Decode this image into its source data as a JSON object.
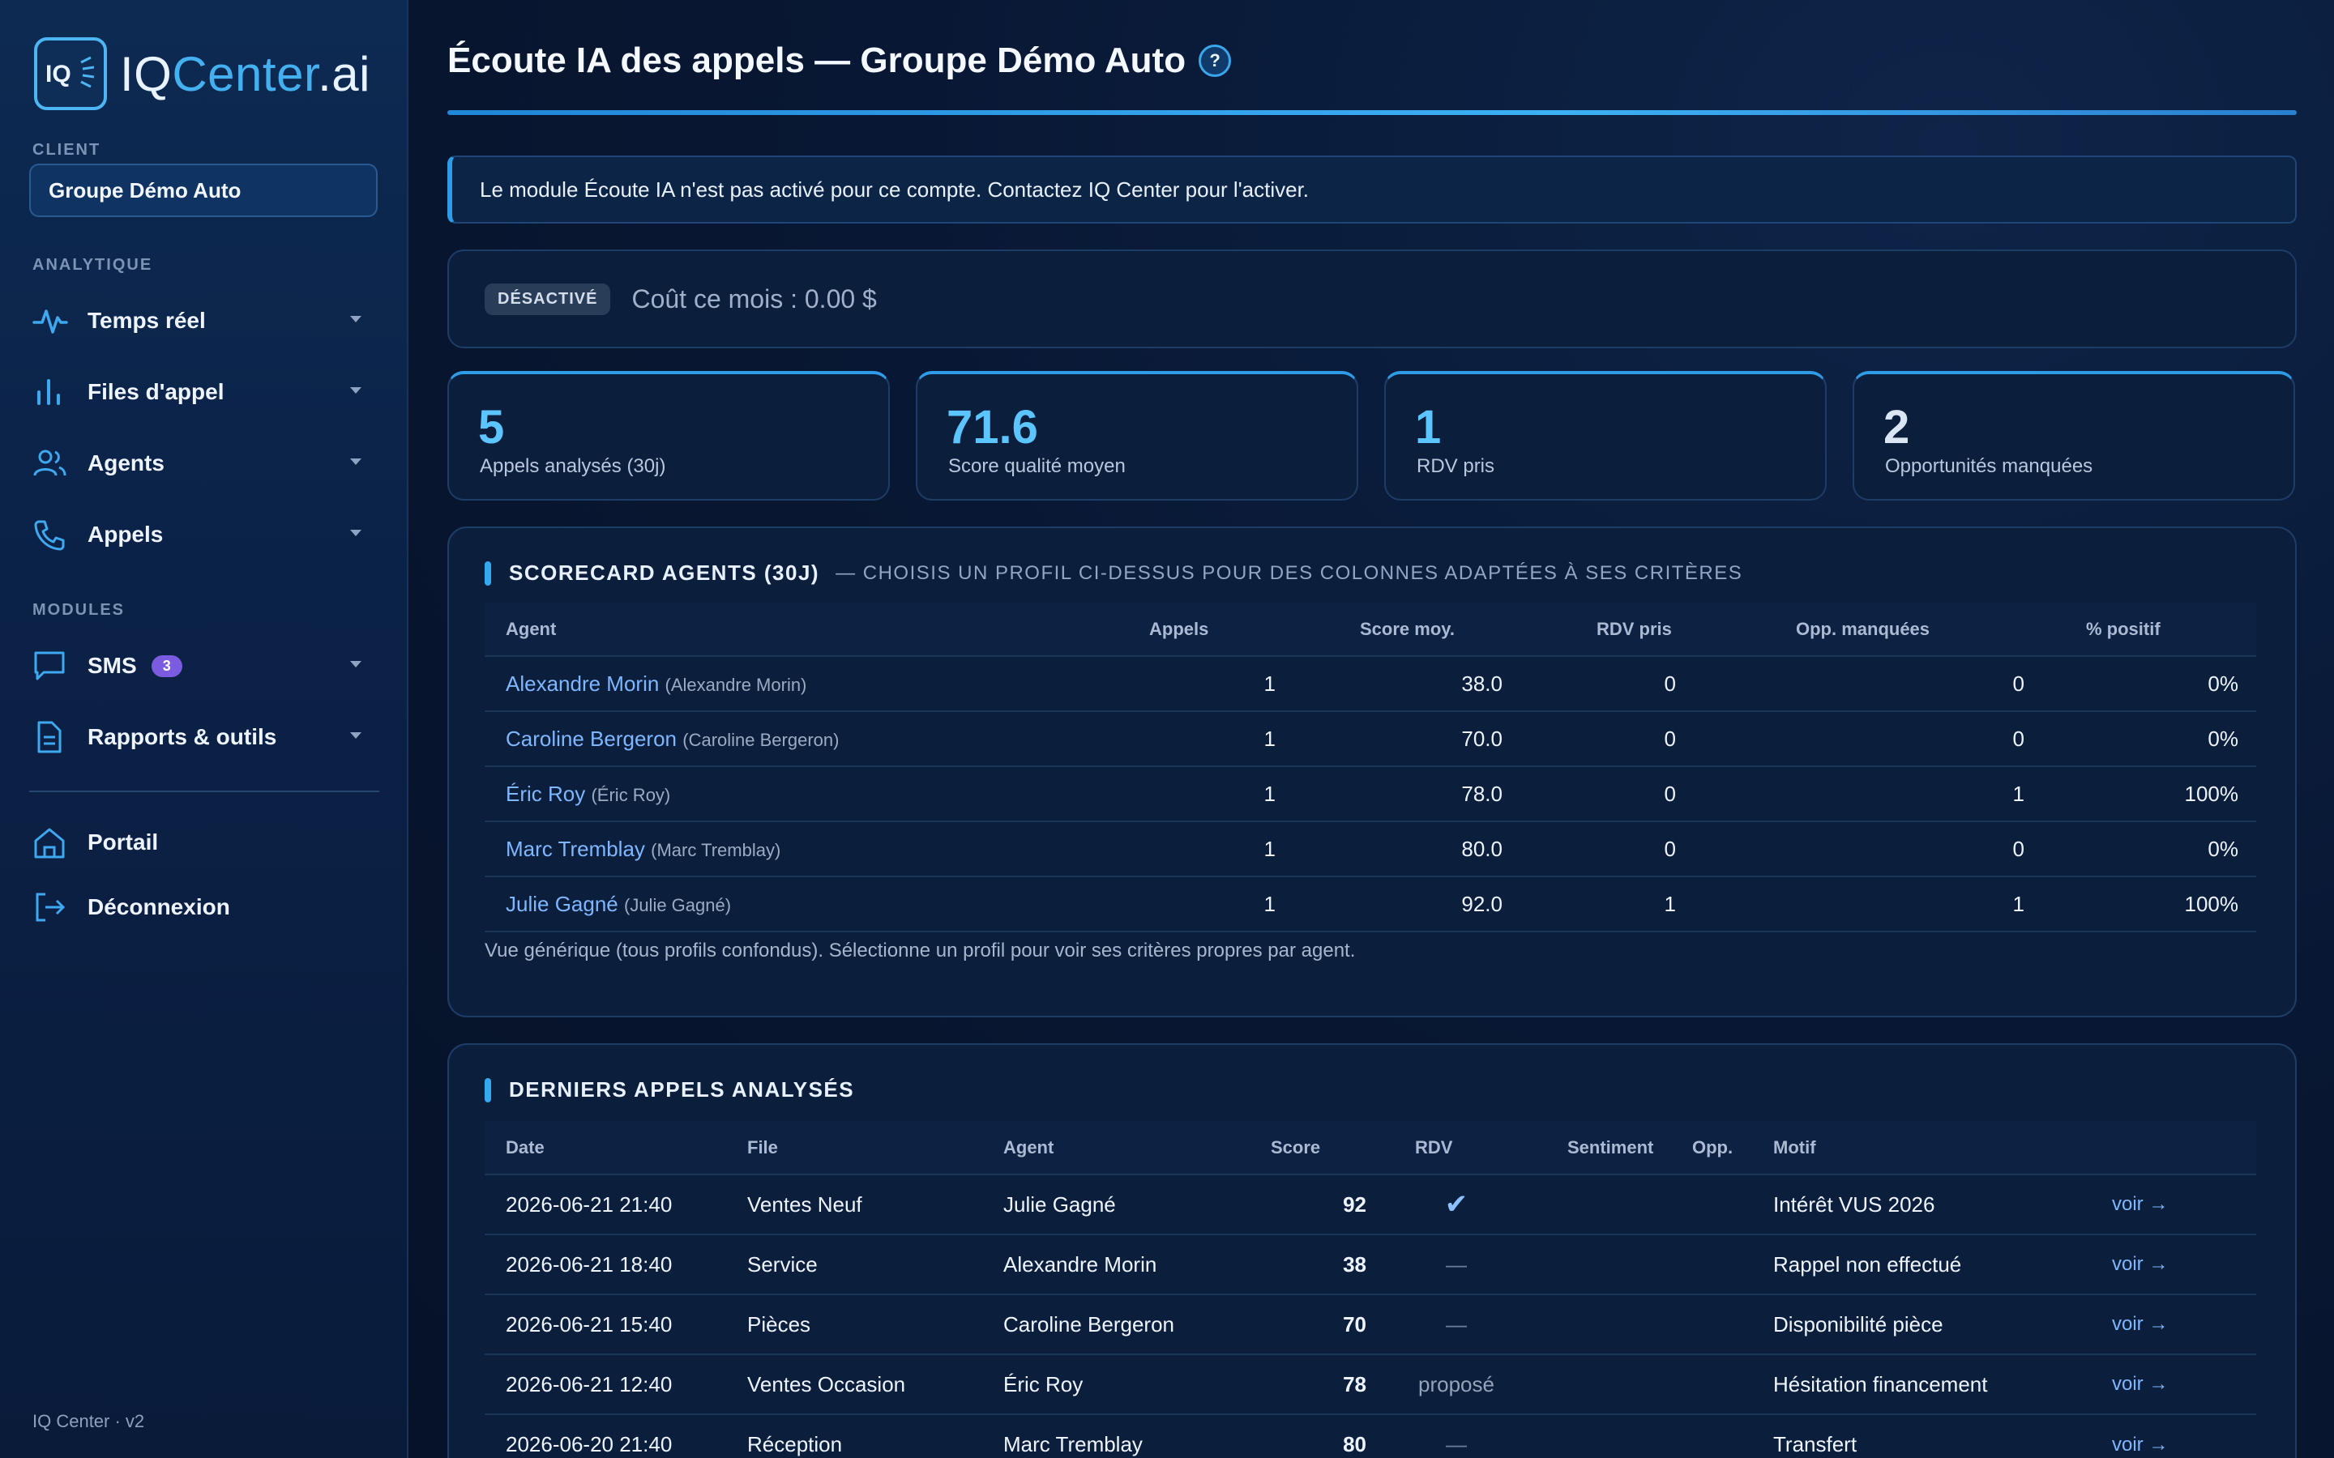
{
  "sidebar": {
    "logo": {
      "prefix": "IQ",
      "name": "Center",
      "suffix": ".ai"
    },
    "client_label": "CLIENT",
    "client_value": "Groupe Démo Auto",
    "analytics_label": "ANALYTIQUE",
    "modules_label": "MODULES",
    "items": [
      {
        "label": "Temps réel",
        "icon": "activity-icon"
      },
      {
        "label": "Files d'appel",
        "icon": "bar-chart-icon"
      },
      {
        "label": "Agents",
        "icon": "users-icon"
      },
      {
        "label": "Appels",
        "icon": "phone-icon"
      },
      {
        "label": "SMS",
        "icon": "message-icon",
        "badge": "3"
      },
      {
        "label": "Rapports & outils",
        "icon": "document-icon"
      },
      {
        "label": "Portail",
        "icon": "home-icon"
      },
      {
        "label": "Déconnexion",
        "icon": "logout-icon"
      }
    ],
    "footer": "IQ Center · v2"
  },
  "header": {
    "title": "Écoute IA des appels — Groupe Démo Auto",
    "help": "?"
  },
  "notice": "Le module Écoute IA n'est pas activé pour ce compte. Contactez IQ Center pour l'activer.",
  "status": {
    "badge": "DÉSACTIVÉ",
    "cost": "Coût ce mois : 0.00 $"
  },
  "kpis": [
    {
      "value": "5",
      "label": "Appels analysés (30j)",
      "color": "#5cc4ff"
    },
    {
      "value": "71.6",
      "label": "Score qualité moyen",
      "color": "#5cc4ff"
    },
    {
      "value": "1",
      "label": "RDV pris",
      "color": "#5cc4ff"
    },
    {
      "value": "2",
      "label": "Opportunités manquées",
      "color": "#dbe6f5"
    }
  ],
  "scorecard": {
    "title": "SCORECARD AGENTS (30J)",
    "subtitle": "— CHOISIS UN PROFIL CI-DESSUS POUR DES COLONNES ADAPTÉES À SES CRITÈRES",
    "columns": [
      "Agent",
      "Appels",
      "Score moy.",
      "RDV pris",
      "Opp. manquées",
      "% positif"
    ],
    "rows": [
      {
        "agent": "Alexandre Morin",
        "sub": "(Alexandre Morin)",
        "appels": "1",
        "score": "38.0",
        "rdv": "0",
        "opp": "0",
        "pos": "0%"
      },
      {
        "agent": "Caroline Bergeron",
        "sub": "(Caroline Bergeron)",
        "appels": "1",
        "score": "70.0",
        "rdv": "0",
        "opp": "0",
        "pos": "0%"
      },
      {
        "agent": "Éric Roy",
        "sub": "(Éric Roy)",
        "appels": "1",
        "score": "78.0",
        "rdv": "0",
        "opp": "1",
        "pos": "100%"
      },
      {
        "agent": "Marc Tremblay",
        "sub": "(Marc Tremblay)",
        "appels": "1",
        "score": "80.0",
        "rdv": "0",
        "opp": "0",
        "pos": "0%"
      },
      {
        "agent": "Julie Gagné",
        "sub": "(Julie Gagné)",
        "appels": "1",
        "score": "92.0",
        "rdv": "1",
        "opp": "1",
        "pos": "100%"
      }
    ],
    "footnote": "Vue générique (tous profils confondus). Sélectionne un profil pour voir ses critères propres par agent."
  },
  "recent": {
    "title": "DERNIERS APPELS ANALYSÉS",
    "columns": [
      "Date",
      "File",
      "Agent",
      "Score",
      "RDV",
      "Sentiment",
      "Opp.",
      "Motif",
      ""
    ],
    "rows": [
      {
        "date": "2026-06-21 21:40",
        "file": "Ventes Neuf",
        "agent": "Julie Gagné",
        "score": "92",
        "rdv": "✔",
        "rdv_kind": "check",
        "sentiment": "",
        "opp": "",
        "motif": "Intérêt VUS 2026",
        "link": "voir →"
      },
      {
        "date": "2026-06-21 18:40",
        "file": "Service",
        "agent": "Alexandre Morin",
        "score": "38",
        "rdv": "—",
        "rdv_kind": "none",
        "sentiment": "",
        "opp": "",
        "motif": "Rappel non effectué",
        "link": "voir →"
      },
      {
        "date": "2026-06-21 15:40",
        "file": "Pièces",
        "agent": "Caroline Bergeron",
        "score": "70",
        "rdv": "—",
        "rdv_kind": "none",
        "sentiment": "",
        "opp": "",
        "motif": "Disponibilité pièce",
        "link": "voir →"
      },
      {
        "date": "2026-06-21 12:40",
        "file": "Ventes Occasion",
        "agent": "Éric Roy",
        "score": "78",
        "rdv": "proposé",
        "rdv_kind": "prop",
        "sentiment": "",
        "opp": "",
        "motif": "Hésitation financement",
        "link": "voir →"
      },
      {
        "date": "2026-06-20 21:40",
        "file": "Réception",
        "agent": "Marc Tremblay",
        "score": "80",
        "rdv": "—",
        "rdv_kind": "none",
        "sentiment": "",
        "opp": "",
        "motif": "Transfert",
        "link": "voir →"
      }
    ]
  }
}
